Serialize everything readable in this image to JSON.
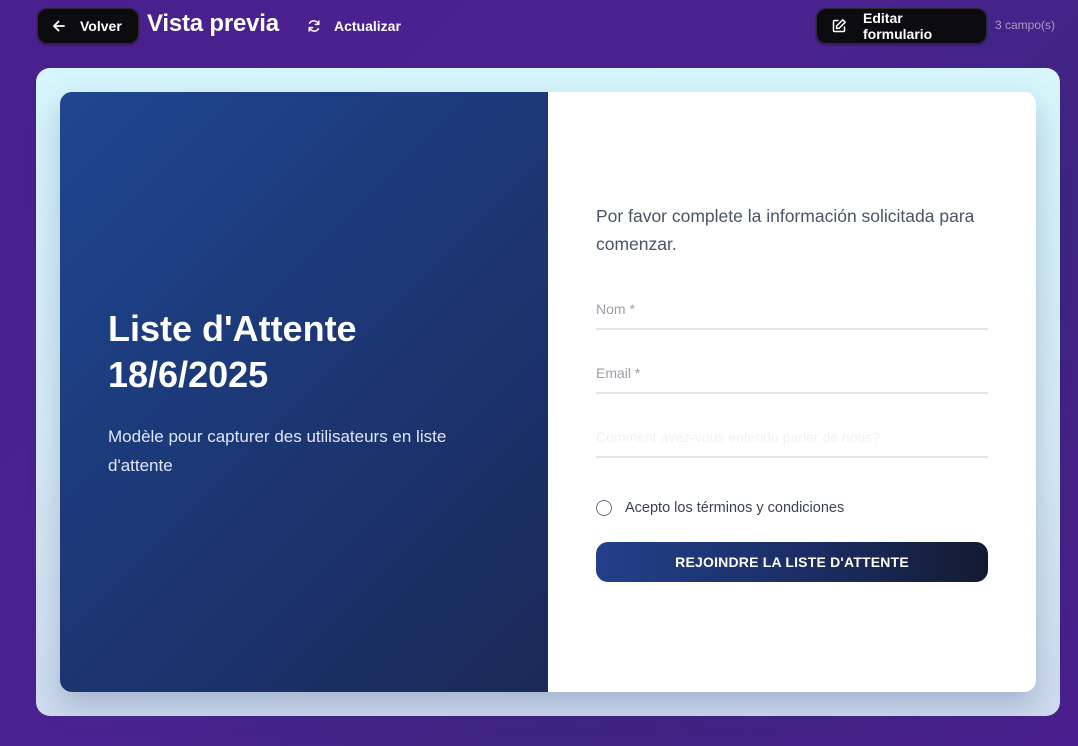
{
  "header": {
    "back_label": "Volver",
    "title": "Vista previa",
    "refresh_label": "Actualizar",
    "edit_label": "Editar formulario",
    "field_count": "3 campo(s)",
    "icons": {
      "back": "arrow-left-icon",
      "refresh": "refresh-icon",
      "edit": "edit-icon"
    }
  },
  "hero": {
    "title": "Liste d'Attente 18/6/2025",
    "subtitle": "Modèle pour capturer des utilisateurs en liste d'attente"
  },
  "form": {
    "intro": "Por favor complete la información solicitada para comenzar.",
    "fields": [
      {
        "placeholder": "Nom *"
      },
      {
        "placeholder": "Email *"
      },
      {
        "placeholder": "Comment avez-vous entendu parler de nous?"
      }
    ],
    "terms_label": "Acepto los términos y condiciones",
    "submit_label": "REJOINDRE LA LISTE D'ATTENTE"
  },
  "colors": {
    "background": "#4a1f8e",
    "hero_panel": "#1c3a7a",
    "submit_button": "#1b2d63"
  }
}
